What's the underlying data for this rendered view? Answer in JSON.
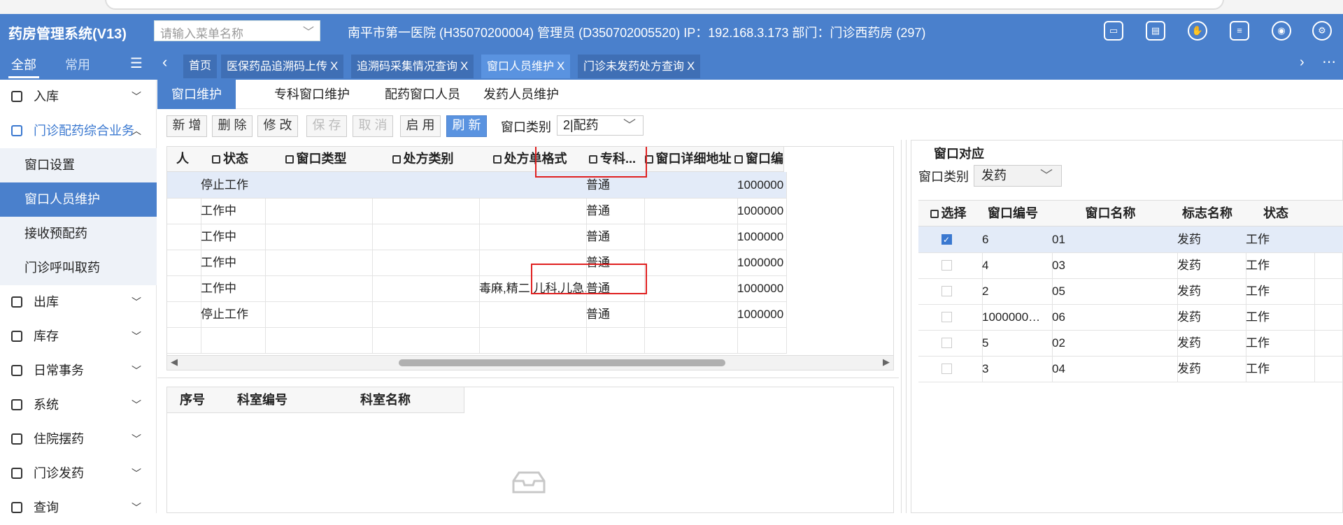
{
  "header": {
    "title": "药房管理系统(V13)",
    "search_placeholder": "请输入菜单名称",
    "info": "南平市第一医院 (H35070200004) 管理员 (D350702005520) IP：192.168.3.173 部门：门诊西药房 (297)",
    "icons": [
      "card-icon",
      "monitor-icon",
      "hand-icon",
      "document-icon",
      "eye-icon",
      "gear-icon"
    ]
  },
  "sidebar": {
    "tab_all": "全部",
    "tab_common": "常用",
    "items": [
      {
        "label": "入库",
        "icon": "inbound-icon"
      },
      {
        "label": "门诊配药综合业务",
        "icon": "dispense-icon"
      },
      {
        "label": "出库",
        "icon": "outbound-icon"
      },
      {
        "label": "库存",
        "icon": "stock-icon"
      },
      {
        "label": "日常事务",
        "icon": "daily-icon"
      },
      {
        "label": "系统",
        "icon": "system-icon"
      },
      {
        "label": "住院摆药",
        "icon": "inpatient-icon"
      },
      {
        "label": "门诊发药",
        "icon": "outpatient-icon"
      },
      {
        "label": "查询",
        "icon": "query-icon"
      }
    ],
    "subitems": [
      "窗口设置",
      "窗口人员维护",
      "接收预配药",
      "门诊呼叫取药"
    ]
  },
  "tabs": [
    {
      "label": "首页",
      "closable": false
    },
    {
      "label": "医保药品追溯码上传",
      "closable": true
    },
    {
      "label": "追溯码采集情况查询",
      "closable": true
    },
    {
      "label": "窗口人员维护",
      "closable": true,
      "active": true
    },
    {
      "label": "门诊未发药处方查询",
      "closable": true
    }
  ],
  "content_tabs": [
    "窗口维护",
    "专科窗口维护",
    "配药窗口人员",
    "发药人员维护"
  ],
  "toolbar": {
    "buttons": [
      "新 增",
      "删 除",
      "修 改",
      "保 存",
      "取 消",
      "启 用",
      "刷 新"
    ],
    "window_type_label": "窗口类别",
    "window_type_value": "2|配药"
  },
  "main_grid": {
    "columns": [
      "人",
      "状态",
      "窗口类型",
      "处方类别",
      "处方单格式",
      "专科...",
      "窗口详细地址",
      "窗口编"
    ],
    "rows": [
      [
        "",
        "停止工作",
        "",
        "",
        "",
        "普通",
        "",
        "1000000"
      ],
      [
        "",
        "工作中",
        "",
        "",
        "",
        "普通",
        "",
        "1000000"
      ],
      [
        "",
        "工作中",
        "",
        "",
        "",
        "普通",
        "",
        "1000000"
      ],
      [
        "",
        "工作中",
        "",
        "",
        "",
        "普通",
        "",
        "1000000"
      ],
      [
        "",
        "工作中",
        "",
        "",
        "毒麻,精二,儿科,儿急…",
        "普通",
        "",
        "1000000"
      ],
      [
        "",
        "停止工作",
        "",
        "",
        "",
        "普通",
        "",
        "1000000"
      ]
    ]
  },
  "dept_grid": {
    "columns": [
      "序号",
      "科室编号",
      "科室名称"
    ]
  },
  "right_panel": {
    "title": "窗口对应",
    "type_label": "窗口类别",
    "type_value": "发药",
    "columns": [
      "选择",
      "窗口编号",
      "窗口名称",
      "标志名称",
      "状态"
    ],
    "rows": [
      {
        "checked": true,
        "code": "6",
        "name": "01",
        "flag": "发药",
        "status": "工作"
      },
      {
        "checked": false,
        "code": "4",
        "name": "03",
        "flag": "发药",
        "status": "工作"
      },
      {
        "checked": false,
        "code": "2",
        "name": "05",
        "flag": "发药",
        "status": "工作"
      },
      {
        "checked": false,
        "code": "1000000…",
        "name": "06",
        "flag": "发药",
        "status": "工作"
      },
      {
        "checked": false,
        "code": "5",
        "name": "02",
        "flag": "发药",
        "status": "工作"
      },
      {
        "checked": false,
        "code": "3",
        "name": "04",
        "flag": "发药",
        "status": "工作"
      }
    ]
  },
  "colors": {
    "primary": "#4a80cc",
    "active_tab": "#5a93e0",
    "highlight": "#e02020"
  }
}
